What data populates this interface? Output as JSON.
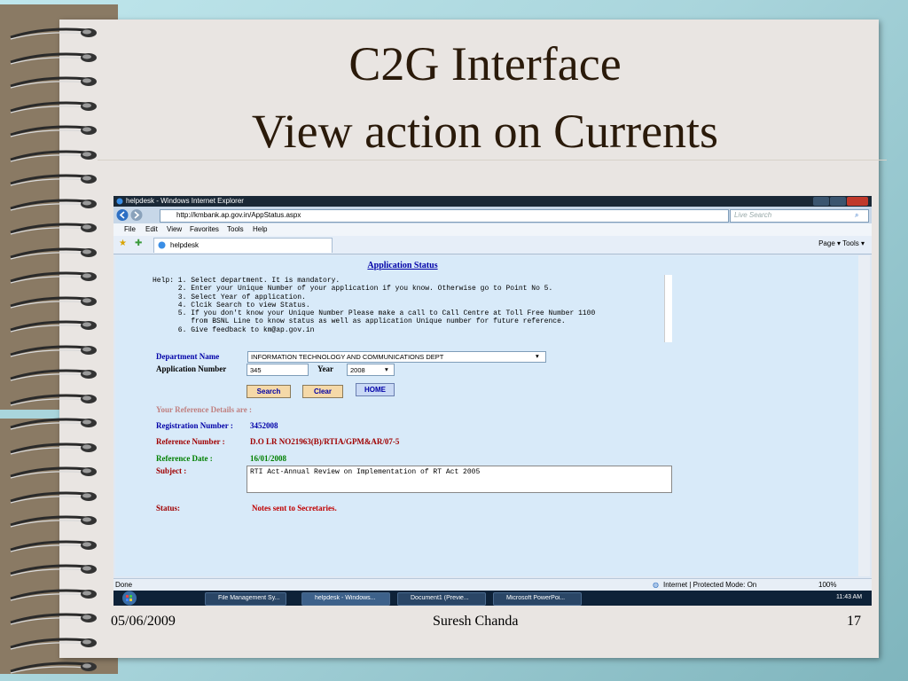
{
  "slide": {
    "title_line1": "C2G Interface",
    "title_line2": "View action on Currents",
    "footer_date": "05/06/2009",
    "footer_author": "Suresh Chanda",
    "footer_page": "17"
  },
  "browser": {
    "window_title": "helpdesk - Windows Internet Explorer",
    "url": "http://kmbank.ap.gov.in/AppStatus.aspx",
    "search_placeholder": "Live Search",
    "menu": [
      "File",
      "Edit",
      "View",
      "Favorites",
      "Tools",
      "Help"
    ],
    "tab_label": "helpdesk",
    "toolbar_right": "Page ▾  Tools ▾",
    "status_left": "Done",
    "status_zone": "Internet | Protected Mode: On",
    "zoom": "100%",
    "taskbar_items": [
      "File Management Sy...",
      "helpdesk - Windows...",
      "Document1 (Previe...",
      "Microsoft PowerPoi..."
    ],
    "clock": "11:43 AM"
  },
  "page": {
    "heading": "Application Status",
    "help_text": "Help: 1. Select department. It is mandatory.\n      2. Enter your Unique Number of your application if you know. Otherwise go to Point No 5.\n      3. Select Year of application.\n      4. Clcik Search to view Status.\n      5. If you don't know your Unique Number Please make a call to Call Centre at Toll Free Number 1100\n         from BSNL Line to know status as well as application Unique number for future reference.\n      6. Give feedback to km@ap.gov.in",
    "dept_label": "Department Name",
    "dept_value": "INFORMATION TECHNOLOGY AND COMMUNICATIONS DEPT",
    "appno_label": "Application Number",
    "appno_value": "345",
    "year_label": "Year",
    "year_value": "2008",
    "search_btn": "Search",
    "clear_btn": "Clear",
    "home_btn": "HOME",
    "ref_header": "Your Reference Details are :",
    "reg_label": "Registration Number :",
    "reg_value": "3452008",
    "refno_label": "Reference Number :",
    "refno_value": "D.O LR NO21963(B)/RTIA/GPM&AR/07-5",
    "refdate_label": "Reference Date :",
    "refdate_value": "16/01/2008",
    "subject_label": "Subject :",
    "subject_value": "RTI Act-Annual Review on Implementation of RT Act 2005",
    "status_label": "Status:",
    "status_value": "Notes sent to Secretaries."
  },
  "colors": {
    "accent_blue": "#0000a8",
    "label_red": "#a00000",
    "label_green": "#008000",
    "ref_header": "#c08080"
  }
}
